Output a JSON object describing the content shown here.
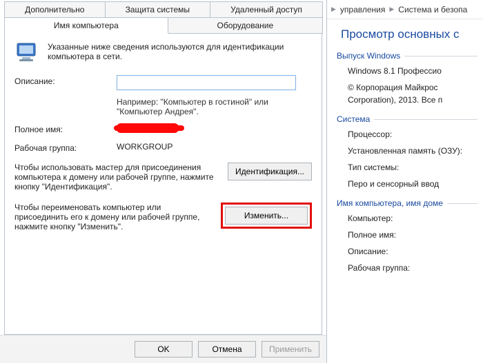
{
  "dialog": {
    "tabs_top": [
      "Дополнительно",
      "Защита системы",
      "Удаленный доступ"
    ],
    "tabs_mid": [
      "Имя компьютера",
      "Оборудование"
    ],
    "intro_text": "Указанные ниже сведения используются для идентификации компьютера в сети.",
    "desc_label": "Описание:",
    "desc_value": "",
    "desc_hint": "Например: \"Компьютер в гостиной\" или \"Компьютер Андрея\".",
    "fullname_label": "Полное имя:",
    "workgroup_label": "Рабочая группа:",
    "workgroup_value": "WORKGROUP",
    "wizard_text": "Чтобы использовать мастер для присоединения компьютера к домену или рабочей группе, нажмите кнопку \"Идентификация\".",
    "ident_btn": "Идентификация...",
    "rename_text": "Чтобы переименовать компьютер или присоединить его к домену или рабочей группе, нажмите кнопку \"Изменить\".",
    "change_btn": "Изменить...",
    "buttons": {
      "ok": "OK",
      "cancel": "Отмена",
      "apply": "Применить"
    }
  },
  "right": {
    "breadcrumb": [
      "управления",
      "Система и безопа"
    ],
    "title": "Просмотр основных с",
    "group_edition": "Выпуск Windows",
    "edition_line1": "Windows 8.1 Профессио",
    "edition_line2": "© Корпорация Майкрос",
    "edition_line3": "Corporation), 2013. Все п",
    "group_system": "Система",
    "sys_cpu": "Процессор:",
    "sys_ram": "Установленная память (ОЗУ):",
    "sys_type": "Тип системы:",
    "sys_pen": "Перо и сенсорный ввод",
    "group_name": "Имя компьютера, имя доме",
    "name_computer": "Компьютер:",
    "name_full": "Полное имя:",
    "name_desc": "Описание:",
    "name_wg": "Рабочая группа:"
  }
}
